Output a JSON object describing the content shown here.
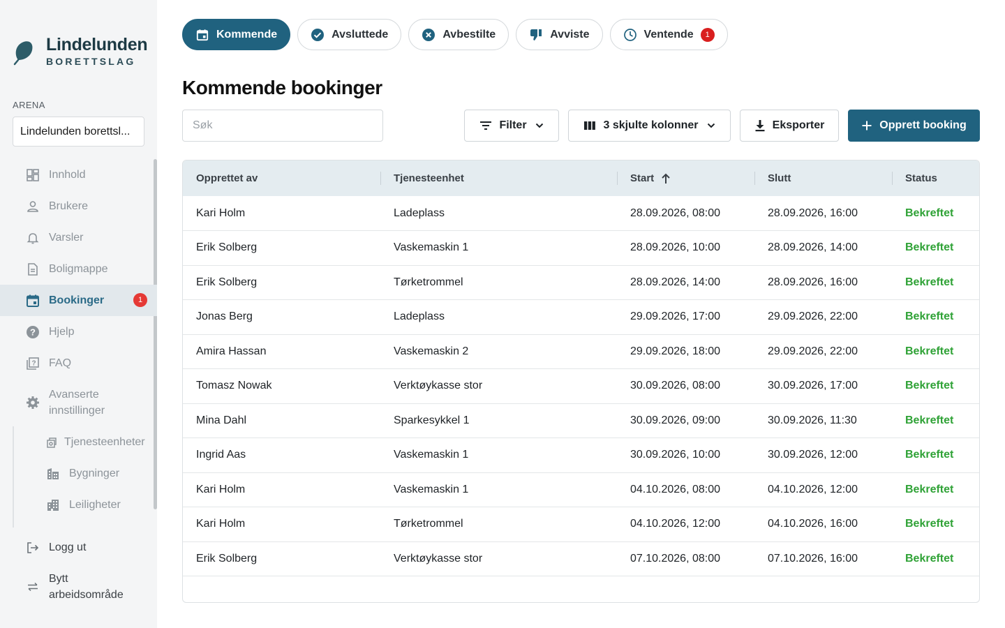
{
  "brand": {
    "name": "Lindelunden",
    "sub": "BORETTSLAG"
  },
  "arena": {
    "label": "ARENA",
    "value": "Lindelunden borettsl..."
  },
  "nav": {
    "items": [
      {
        "label": "Innhold",
        "icon": "dashboard-icon"
      },
      {
        "label": "Brukere",
        "icon": "person-icon"
      },
      {
        "label": "Varsler",
        "icon": "bell-icon"
      },
      {
        "label": "Boligmappe",
        "icon": "document-icon"
      },
      {
        "label": "Bookinger",
        "icon": "calendar-icon",
        "badge": "1"
      },
      {
        "label": "Hjelp",
        "icon": "help-icon"
      },
      {
        "label": "FAQ",
        "icon": "faq-icon"
      },
      {
        "label": "Avanserte innstillinger",
        "icon": "gear-icon"
      }
    ],
    "subitems": [
      {
        "label": "Tjenesteenheter",
        "icon": "service-unit-icon"
      },
      {
        "label": "Bygninger",
        "icon": "building-icon"
      },
      {
        "label": "Leiligheter",
        "icon": "apartment-icon"
      }
    ],
    "logout": "Logg ut",
    "switch_workspace": "Bytt arbeidsområde"
  },
  "tabs": [
    {
      "label": "Kommende",
      "icon": "calendar-icon",
      "active": true
    },
    {
      "label": "Avsluttede",
      "icon": "check-circle-icon"
    },
    {
      "label": "Avbestilte",
      "icon": "cancel-circle-icon"
    },
    {
      "label": "Avviste",
      "icon": "thumb-down-icon"
    },
    {
      "label": "Ventende",
      "icon": "clock-icon",
      "badge": "1"
    }
  ],
  "page": {
    "title": "Kommende bookinger"
  },
  "toolbar": {
    "search_placeholder": "Søk",
    "filter": "Filter",
    "columns": "3 skjulte kolonner",
    "export": "Eksporter",
    "create": "Opprett booking"
  },
  "table": {
    "columns": [
      "Opprettet av",
      "Tjenesteenhet",
      "Start",
      "Slutt",
      "Status"
    ],
    "sorted_column": "Start",
    "rows": [
      [
        "Kari Holm",
        "Ladeplass",
        "28.09.2026, 08:00",
        "28.09.2026, 16:00",
        "Bekreftet"
      ],
      [
        "Erik Solberg",
        "Vaskemaskin 1",
        "28.09.2026, 10:00",
        "28.09.2026, 14:00",
        "Bekreftet"
      ],
      [
        "Erik Solberg",
        "Tørketrommel",
        "28.09.2026, 14:00",
        "28.09.2026, 16:00",
        "Bekreftet"
      ],
      [
        "Jonas Berg",
        "Ladeplass",
        "29.09.2026, 17:00",
        "29.09.2026, 22:00",
        "Bekreftet"
      ],
      [
        "Amira Hassan",
        "Vaskemaskin 2",
        "29.09.2026, 18:00",
        "29.09.2026, 22:00",
        "Bekreftet"
      ],
      [
        "Tomasz Nowak",
        "Verktøykasse stor",
        "30.09.2026, 08:00",
        "30.09.2026, 17:00",
        "Bekreftet"
      ],
      [
        "Mina Dahl",
        "Sparkesykkel 1",
        "30.09.2026, 09:00",
        "30.09.2026, 11:30",
        "Bekreftet"
      ],
      [
        "Ingrid Aas",
        "Vaskemaskin 1",
        "30.09.2026, 10:00",
        "30.09.2026, 12:00",
        "Bekreftet"
      ],
      [
        "Kari Holm",
        "Vaskemaskin 1",
        "04.10.2026, 08:00",
        "04.10.2026, 12:00",
        "Bekreftet"
      ],
      [
        "Kari Holm",
        "Tørketrommel",
        "04.10.2026, 12:00",
        "04.10.2026, 16:00",
        "Bekreftet"
      ],
      [
        "Erik Solberg",
        "Verktøykasse stor",
        "07.10.2026, 08:00",
        "07.10.2026, 16:00",
        "Bekreftet"
      ]
    ]
  },
  "colors": {
    "primary": "#20627f",
    "status_confirmed": "#2fa236",
    "badge": "#e53935",
    "brand_dark": "#1d3a44"
  }
}
